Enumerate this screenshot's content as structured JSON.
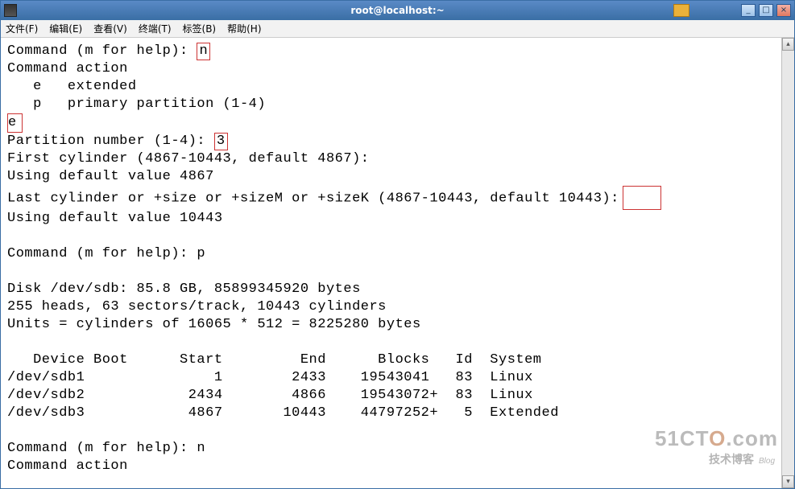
{
  "window": {
    "title": "root@localhost:~"
  },
  "menu": {
    "file": "文件(F)",
    "edit": "编辑(E)",
    "view": "查看(V)",
    "terminal": "终端(T)",
    "tabs": "标签(B)",
    "help": "帮助(H)"
  },
  "term": {
    "l1a": "Command (m for help): ",
    "l1b": "n",
    "l2": "Command action",
    "l3": "   e   extended",
    "l4": "   p   primary partition (1-4)",
    "l5": "e",
    "l6a": "Partition number (1-4): ",
    "l6b": "3",
    "l7": "First cylinder (4867-10443, default 4867):",
    "l8": "Using default value 4867",
    "l9": "Last cylinder or +size or +sizeM or +sizeK (4867-10443, default 10443):",
    "l10": "Using default value 10443",
    "l11": "",
    "l12": "Command (m for help): p",
    "l13": "",
    "l14": "Disk /dev/sdb: 85.8 GB, 85899345920 bytes",
    "l15": "255 heads, 63 sectors/track, 10443 cylinders",
    "l16": "Units = cylinders of 16065 * 512 = 8225280 bytes",
    "l17": "",
    "th": "   Device Boot      Start         End      Blocks   Id  System",
    "r1": "/dev/sdb1               1        2433    19543041   83  Linux",
    "r2": "/dev/sdb2            2434        4866    19543072+  83  Linux",
    "r3": "/dev/sdb3            4867       10443    44797252+   5  Extended",
    "l22": "",
    "l23": "Command (m for help): n",
    "l24": "Command action"
  },
  "partition_table": {
    "disk": "/dev/sdb",
    "size_gb": 85.8,
    "size_bytes": 85899345920,
    "heads": 255,
    "sectors_per_track": 63,
    "cylinders": 10443,
    "unit_cylinders": 16065,
    "unit_bytes": 8225280,
    "columns": [
      "Device",
      "Boot",
      "Start",
      "End",
      "Blocks",
      "Id",
      "System"
    ],
    "rows": [
      {
        "device": "/dev/sdb1",
        "boot": "",
        "start": 1,
        "end": 2433,
        "blocks": "19543041",
        "id": "83",
        "system": "Linux"
      },
      {
        "device": "/dev/sdb2",
        "boot": "",
        "start": 2434,
        "end": 4866,
        "blocks": "19543072+",
        "id": "83",
        "system": "Linux"
      },
      {
        "device": "/dev/sdb3",
        "boot": "",
        "start": 4867,
        "end": 10443,
        "blocks": "44797252+",
        "id": "5",
        "system": "Extended"
      }
    ]
  },
  "watermark": {
    "brand_a": "51CT",
    "brand_b": "O",
    "brand_c": ".com",
    "line2": "技术博客",
    "blog": "Blog"
  },
  "scroll": {
    "up": "▴",
    "down": "▾"
  }
}
